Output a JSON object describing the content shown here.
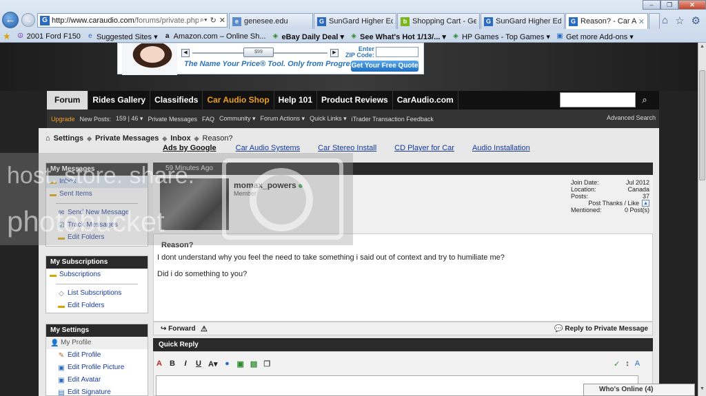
{
  "browser": {
    "url_host": "http://www.caraudio.com",
    "url_rest": "/forums/private.php?do",
    "tabs": [
      {
        "label": "genesee.edu",
        "icon": "ie-page-icon",
        "color": "#5b8cc9"
      },
      {
        "label": "SunGard Higher Educati...",
        "icon": "sungard-g-icon",
        "color": "#2a6bc1"
      },
      {
        "label": "Shopping Cart - Genese...",
        "icon": "bn-store-icon",
        "color": "#7ab51d"
      },
      {
        "label": "SunGard Higher Educati...",
        "icon": "sungard-g-icon",
        "color": "#2a6bc1"
      },
      {
        "label": "Reason? - Car Audio ...",
        "icon": "sungard-g-icon",
        "color": "#2a6bc1",
        "active": true
      }
    ],
    "bookmarks": [
      {
        "label": "2001 Ford F150",
        "icon": "peace-icon"
      },
      {
        "label": "Suggested Sites ▾",
        "icon": "ie-icon"
      },
      {
        "label": "Amazon.com – Online Sh...",
        "icon": "amazon-icon"
      },
      {
        "label": "eBay Daily Deal ▾",
        "icon": "webslice-icon"
      },
      {
        "label": "See What's Hot 1/13/... ▾",
        "icon": "webslice-icon"
      },
      {
        "label": "HP Games - Top Games ▾",
        "icon": "webslice-icon"
      },
      {
        "label": "Get more Add-ons ▾",
        "icon": "addon-icon"
      }
    ]
  },
  "ad": {
    "tagline": "The Name Your Price® Tool. Only from Progressive",
    "zip_label_1": "Enter",
    "zip_label_2": "ZIP Code:",
    "quote_button": "Get Your Free Quote",
    "slider_amount": "$99"
  },
  "nav": {
    "tabs": [
      "Forum",
      "Rides Gallery",
      "Classifieds",
      "Car Audio Shop",
      "Help 101",
      "Product Reviews",
      "CarAudio.com"
    ]
  },
  "subnav": {
    "upgrade": "Upgrade",
    "new_posts": "New Posts:",
    "counts": "159 | 46 ▾",
    "items": [
      "Private Messages",
      "FAQ",
      "Community ▾",
      "Forum Actions ▾",
      "Quick Links ▾",
      "iTrader Transaction Feedback"
    ],
    "advanced_search": "Advanced Search"
  },
  "breadcrumb": {
    "settings": "Settings",
    "pm": "Private Messages",
    "inbox": "Inbox",
    "current": "Reason?"
  },
  "ads_row": {
    "label": "Ads by Google",
    "links": [
      "Car Audio Systems",
      "Car Stereo Install",
      "CD Player for Car",
      "Audio Installation"
    ]
  },
  "sidebar": {
    "my_messages": {
      "title": "My Messages",
      "items": [
        "Inbox",
        "Sent Items",
        "Send New Message",
        "Track Messages",
        "Edit Folders"
      ]
    },
    "my_subscriptions": {
      "title": "My Subscriptions",
      "items": [
        "Subscriptions",
        "List Subscriptions",
        "Edit Folders"
      ]
    },
    "my_settings": {
      "title": "My Settings",
      "items": [
        "My Profile",
        "Edit Profile",
        "Edit Profile Picture",
        "Edit Avatar",
        "Edit Signature"
      ]
    }
  },
  "post": {
    "time": "59 Minutes Ago",
    "username": "momax_powers",
    "rank": "Member",
    "stats": [
      {
        "label": "Join Date:",
        "value": "Jul 2012"
      },
      {
        "label": "Location:",
        "value": "Canada"
      },
      {
        "label": "Posts:",
        "value": "37"
      },
      {
        "label": "Post Thanks / Like",
        "value": ""
      },
      {
        "label": "Mentioned:",
        "value": "0 Post(s)"
      }
    ],
    "title": "Reason?",
    "line1": "I dont understand why you feel the need to take something i said out of context and try to humiliate me?",
    "line2": "Did i do something to you?",
    "forward": "Forward",
    "reply": "Reply to Private Message"
  },
  "quick_reply": {
    "title": "Quick Reply"
  },
  "who_online": "Who's Online (4)",
  "watermark": {
    "line1": "host. store. share.",
    "line2": "photobucket"
  }
}
